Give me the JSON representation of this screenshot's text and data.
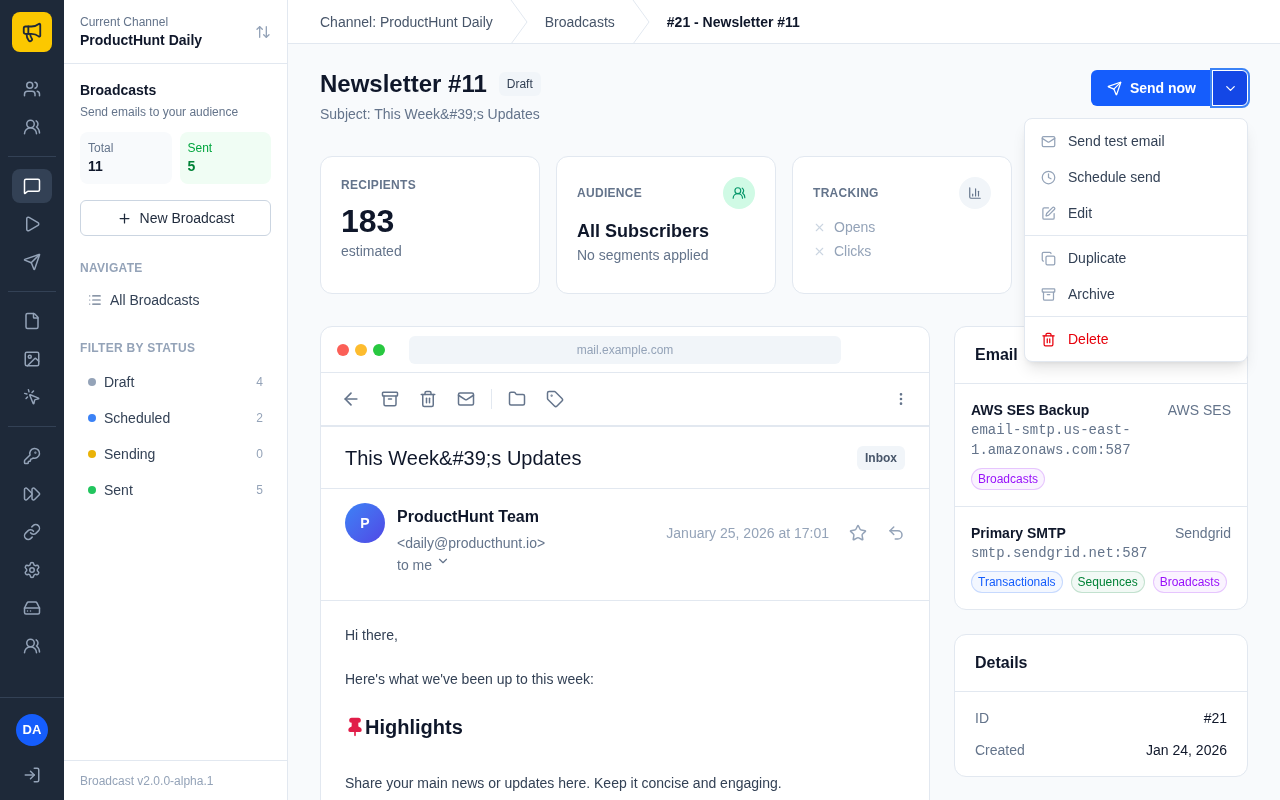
{
  "rail": {
    "items": [
      {
        "selected": false
      },
      {
        "selected": false
      },
      {
        "selected": true
      },
      {
        "selected": false
      },
      {
        "selected": false
      },
      {
        "selected": false
      },
      {
        "selected": false
      },
      {
        "selected": false
      },
      {
        "selected": false
      },
      {
        "selected": false
      },
      {
        "selected": false
      },
      {
        "selected": false
      },
      {
        "selected": false
      },
      {
        "selected": false
      }
    ],
    "avatar": "DA"
  },
  "channel": {
    "label": "Current Channel",
    "name": "ProductHunt Daily"
  },
  "section": {
    "title": "Broadcasts",
    "subtitle": "Send emails to your audience"
  },
  "stats": [
    {
      "label": "Total",
      "value": "11",
      "kind": "neutral"
    },
    {
      "label": "Sent",
      "value": "5",
      "kind": "success"
    }
  ],
  "new_button": "New Broadcast",
  "navigate": {
    "heading": "NAVIGATE",
    "items": [
      {
        "label": "All Broadcasts",
        "selected": false
      }
    ]
  },
  "filters": {
    "heading": "FILTER BY STATUS",
    "items": [
      {
        "label": "Draft",
        "count": "4",
        "color": "#94a3b8"
      },
      {
        "label": "Scheduled",
        "count": "2",
        "color": "#3b82f6"
      },
      {
        "label": "Sending",
        "count": "0",
        "color": "#eab308"
      },
      {
        "label": "Sent",
        "count": "5",
        "color": "#22c55e"
      }
    ]
  },
  "version": "Broadcast v2.0.0-alpha.1",
  "breadcrumbs": [
    "Channel: ProductHunt Daily",
    "Broadcasts",
    "#21 - Newsletter #11"
  ],
  "header": {
    "title": "Newsletter #11",
    "status": "Draft",
    "subject": "Subject: This Week&#39;s Updates"
  },
  "send_button": "Send now",
  "menu": {
    "groups": [
      [
        {
          "label": "Send test email",
          "kind": "mail"
        },
        {
          "label": "Schedule send",
          "kind": "clock"
        },
        {
          "label": "Edit",
          "kind": "edit"
        }
      ],
      [
        {
          "label": "Duplicate",
          "kind": "copy"
        },
        {
          "label": "Archive",
          "kind": "archive"
        }
      ],
      [
        {
          "label": "Delete",
          "kind": "delete"
        }
      ]
    ]
  },
  "cards": [
    {
      "kind": "recipients",
      "label": "RECIPIENTS",
      "value": "183",
      "note": "estimated"
    },
    {
      "kind": "audience",
      "label": "AUDIENCE",
      "value": "All Subscribers",
      "note": "No segments applied"
    },
    {
      "kind": "tracking",
      "label": "TRACKING",
      "items": [
        {
          "label": "Opens",
          "on": false
        },
        {
          "label": "Clicks",
          "on": false
        }
      ]
    }
  ],
  "preview": {
    "url": "mail.example.com",
    "subject": "This Week&#39;s Updates",
    "folder": "Inbox",
    "avatar": "P",
    "sender": "ProductHunt Team",
    "email": "<daily@producthunt.io>",
    "recipient": "to me",
    "date": "January 25, 2026 at 17:01",
    "body": [
      {
        "kind": "p",
        "text": "Hi there,"
      },
      {
        "kind": "p",
        "text": "Here's what we've been up to this week:"
      },
      {
        "kind": "h",
        "text": "Highlights"
      },
      {
        "kind": "p",
        "text": "Share your main news or updates here. Keep it concise and engaging."
      }
    ]
  },
  "servers": {
    "title": "Email",
    "items": [
      {
        "name": "AWS SES Backup",
        "provider": "AWS SES",
        "host": "email-smtp.us-east-1.amazonaws.com:587",
        "tags": [
          {
            "label": "Broadcasts",
            "color": "#9810fa"
          }
        ]
      },
      {
        "name": "Primary SMTP",
        "provider": "Sendgrid",
        "host": "smtp.sendgrid.net:587",
        "tags": [
          {
            "label": "Transactionals",
            "color": "#155dfc"
          },
          {
            "label": "Sequences",
            "color": "#008236"
          },
          {
            "label": "Broadcasts",
            "color": "#9810fa"
          }
        ]
      }
    ]
  },
  "details": {
    "title": "Details",
    "rows": [
      {
        "label": "ID",
        "value": "#21"
      },
      {
        "label": "Created",
        "value": "Jan 24, 2026"
      }
    ]
  }
}
